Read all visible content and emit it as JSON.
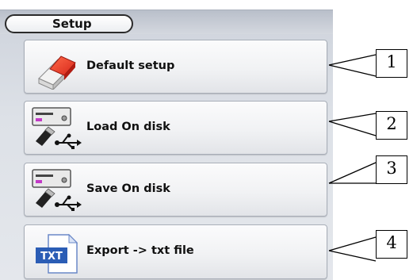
{
  "tab": {
    "label": "Setup"
  },
  "buttons": [
    {
      "label": "Default setup",
      "icon": "eraser-icon"
    },
    {
      "label": "Load On disk",
      "icon": "disk-usb-icon"
    },
    {
      "label": "Save On disk",
      "icon": "disk-usb-icon"
    },
    {
      "label": "Export -> txt file",
      "icon": "txt-file-icon",
      "icon_text": "TXT"
    }
  ],
  "callouts": [
    "1",
    "2",
    "3",
    "4"
  ]
}
